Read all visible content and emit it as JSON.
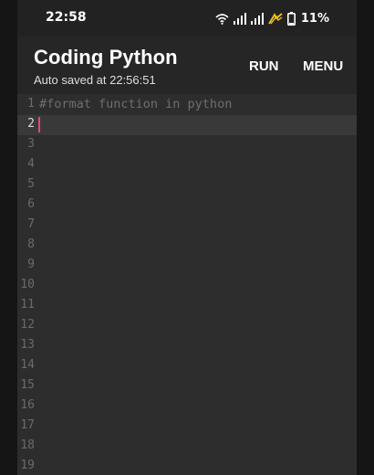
{
  "statusbar": {
    "time": "22:58",
    "battery": "11%",
    "icons": [
      "wifi-icon",
      "signal-icon",
      "signal-icon",
      "data-saver-icon",
      "battery-icon"
    ]
  },
  "appbar": {
    "title": "Coding Python",
    "subtitle": "Auto saved at 22:56:51",
    "run_label": "RUN",
    "menu_label": "MENU"
  },
  "editor": {
    "active_line": 2,
    "lines": [
      {
        "number": "1",
        "code": "#format function in python"
      },
      {
        "number": "2",
        "code": ""
      },
      {
        "number": "3",
        "code": ""
      },
      {
        "number": "4",
        "code": ""
      },
      {
        "number": "5",
        "code": ""
      },
      {
        "number": "6",
        "code": ""
      },
      {
        "number": "7",
        "code": ""
      },
      {
        "number": "8",
        "code": ""
      },
      {
        "number": "9",
        "code": ""
      },
      {
        "number": "10",
        "code": ""
      },
      {
        "number": "11",
        "code": ""
      },
      {
        "number": "12",
        "code": ""
      },
      {
        "number": "13",
        "code": ""
      },
      {
        "number": "14",
        "code": ""
      },
      {
        "number": "15",
        "code": ""
      },
      {
        "number": "16",
        "code": ""
      },
      {
        "number": "17",
        "code": ""
      },
      {
        "number": "18",
        "code": ""
      },
      {
        "number": "19",
        "code": ""
      }
    ]
  }
}
